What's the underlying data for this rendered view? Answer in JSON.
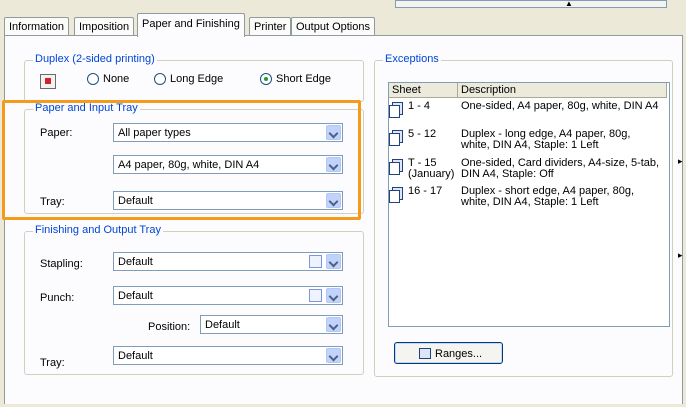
{
  "tabs": [
    "Information",
    "Imposition",
    "Paper and Finishing",
    "Printer",
    "Output Options"
  ],
  "duplex": {
    "legend": "Duplex (2-sided printing)",
    "options": [
      "None",
      "Long Edge",
      "Short Edge"
    ],
    "selected": "Short Edge"
  },
  "paper_tray": {
    "legend": "Paper and Input Tray",
    "paper_label": "Paper:",
    "paper_type": "All paper types",
    "paper_value": "A4 paper, 80g, white, DIN A4",
    "tray_label": "Tray:",
    "tray_value": "Default"
  },
  "finishing": {
    "legend": "Finishing and Output Tray",
    "stapling_label": "Stapling:",
    "stapling_value": "Default",
    "punch_label": "Punch:",
    "punch_value": "Default",
    "position_label": "Position:",
    "position_value": "Default",
    "tray_label": "Tray:",
    "tray_value": "Default"
  },
  "exceptions": {
    "legend": "Exceptions",
    "headers": [
      "Sheet",
      "Description"
    ],
    "rows": [
      {
        "sheet": "1 - 4",
        "desc": "One-sided, A4 paper, 80g, white, DIN A4"
      },
      {
        "sheet": "5 - 12",
        "desc": "Duplex - long edge, A4 paper, 80g, white, DIN A4, Staple: 1 Left"
      },
      {
        "sheet": "T - 15\n(January)",
        "desc": "One-sided, Card dividers, A4-size, 5-tab, DIN A4, Staple: Off"
      },
      {
        "sheet": "16 - 17",
        "desc": "Duplex - short edge, A4 paper, 80g, white, DIN A4, Staple: 1 Left"
      }
    ],
    "ranges_button": "Ranges..."
  },
  "highlight_color": "#f59a1a",
  "accent_color": "#0046d5"
}
